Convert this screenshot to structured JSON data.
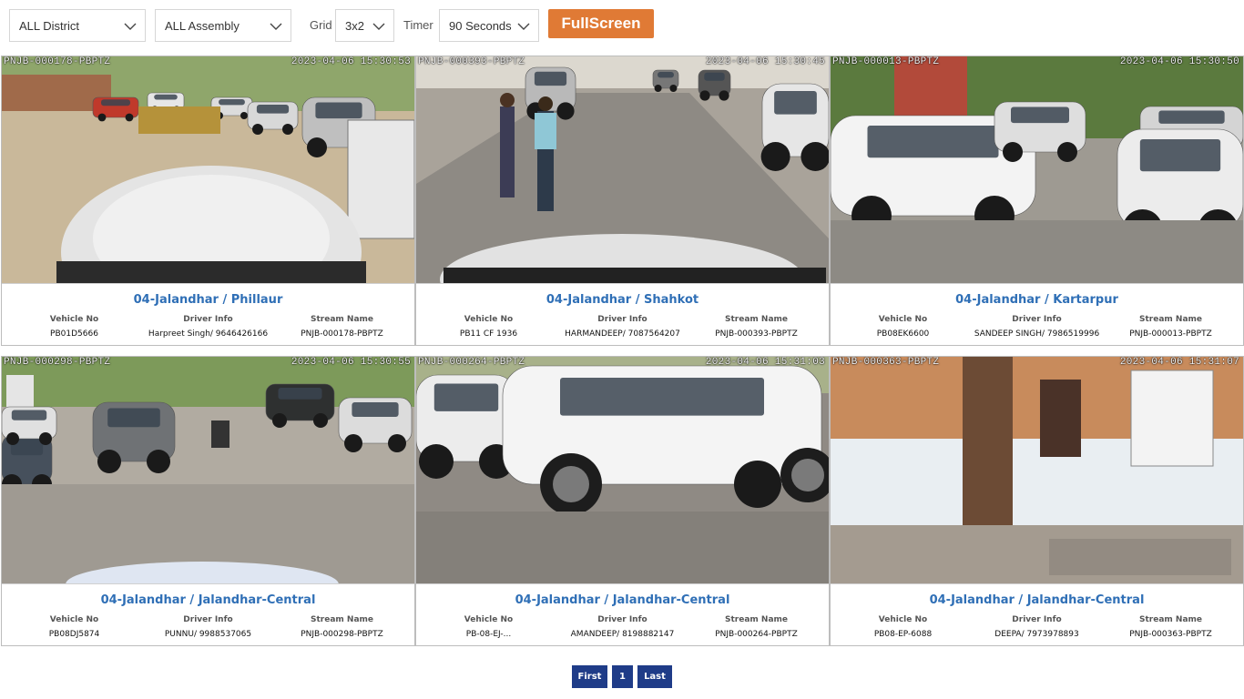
{
  "filters": {
    "district": "ALL District",
    "assembly": "ALL Assembly",
    "grid_label": "Grid",
    "grid_value": "3x2",
    "timer_label": "Timer",
    "timer_value": "90 Seconds",
    "fullscreen_label": "FullScreen"
  },
  "column_headers": {
    "vehicle": "Vehicle No",
    "driver": "Driver Info",
    "stream": "Stream Name"
  },
  "tiles": [
    {
      "osd_left": "PNJB-000178-PBPTZ",
      "osd_right": "2023-04-06 15:30:53",
      "location": "04-Jalandhar / Phillaur",
      "vehicle_no": "PB01D5666",
      "driver_info": "Harpreet Singh/ 9646426166",
      "stream_name": "PNJB-000178-PBPTZ",
      "scene": "yard"
    },
    {
      "osd_left": "PNJB-000393-PBPTZ",
      "osd_right": "2023-04-06 15:30:45",
      "location": "04-Jalandhar / Shahkot",
      "vehicle_no": "PB11 CF 1936",
      "driver_info": "HARMANDEEP/ 7087564207",
      "stream_name": "PNJB-000393-PBPTZ",
      "scene": "street"
    },
    {
      "osd_left": "PNJB-000013-PBPTZ",
      "osd_right": "2023-04-06 15:30:50",
      "location": "04-Jalandhar / Kartarpur",
      "vehicle_no": "PB08EK6600",
      "driver_info": "SANDEEP SINGH/ 7986519996",
      "stream_name": "PNJB-000013-PBPTZ",
      "scene": "parking"
    },
    {
      "osd_left": "PNJB-000298-PBPTZ",
      "osd_right": "2023-04-06 15:30:55",
      "location": "04-Jalandhar / Jalandhar-Central",
      "vehicle_no": "PB08DJ5874",
      "driver_info": "PUNNU/ 9988537065",
      "stream_name": "PNJB-000298-PBPTZ",
      "scene": "lot"
    },
    {
      "osd_left": "PNJB-000264-PBPTZ",
      "osd_right": "2023-04-06 15:31:03",
      "location": "04-Jalandhar / Jalandhar-Central",
      "vehicle_no": "PB-08-EJ-...",
      "driver_info": "AMANDEEP/ 8198882147",
      "stream_name": "PNJB-000264-PBPTZ",
      "scene": "suv"
    },
    {
      "osd_left": "PNJB-000363-PBPTZ",
      "osd_right": "2023-04-06 15:31:07",
      "location": "04-Jalandhar / Jalandhar-Central",
      "vehicle_no": "PB08-EP-6088",
      "driver_info": "DEEPA/ 7973978893",
      "stream_name": "PNJB-000363-PBPTZ",
      "scene": "building"
    }
  ],
  "pagination": {
    "first": "First",
    "page": "1",
    "last": "Last"
  },
  "colors": {
    "accent": "#e07a35",
    "link_blue": "#2f6fb6",
    "pager_blue": "#1f3c88"
  }
}
